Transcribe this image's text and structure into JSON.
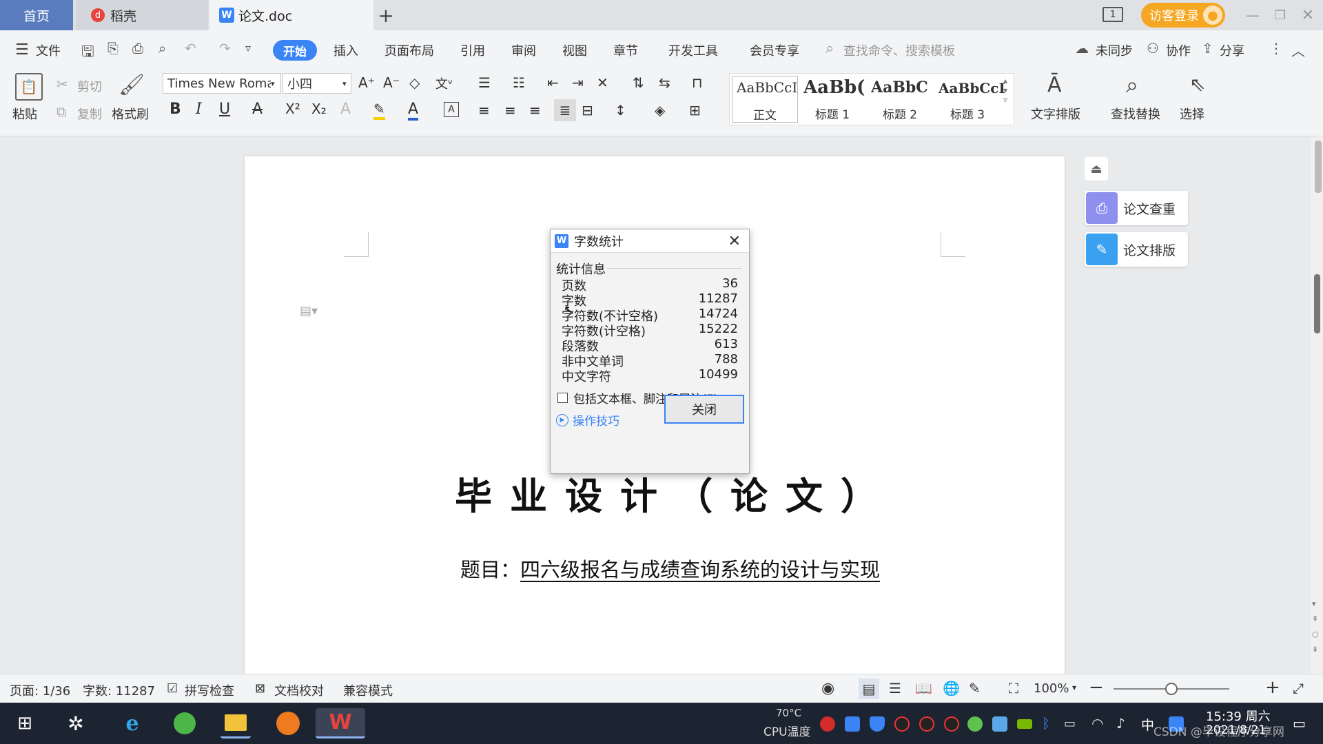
{
  "tabs": {
    "home": "首页",
    "daoke": "稻壳",
    "doc": "论文.doc",
    "add": "+"
  },
  "window": {
    "login": "访客登录",
    "page_indicator": "1"
  },
  "menubar": {
    "file": "文件",
    "items": [
      "开始",
      "插入",
      "页面布局",
      "引用",
      "审阅",
      "视图",
      "章节",
      "开发工具",
      "会员专享"
    ],
    "search_placeholder": "查找命令、搜索模板",
    "sync": "未同步",
    "collab": "协作",
    "share": "分享"
  },
  "ribbon": {
    "paste": "粘贴",
    "cut": "剪切",
    "copy": "复制",
    "format_painter": "格式刷",
    "font_name": "Times New Roman",
    "font_size": "小四",
    "styles": [
      {
        "preview": "AaBbCcI",
        "caption": "正文"
      },
      {
        "preview": "AaBb(",
        "caption": "标题 1"
      },
      {
        "preview": "AaBbC",
        "caption": "标题 2"
      },
      {
        "preview": "AaBbCcI",
        "caption": "标题 3"
      }
    ],
    "text_layout": "文字排版",
    "find_replace": "查找替换",
    "select": "选择"
  },
  "side_panel": {
    "check": "论文查重",
    "layout": "论文排版"
  },
  "document": {
    "title": "毕业设计（论文）",
    "subject_label": "题目：",
    "subject": "四六级报名与成绩查询系统的设计与实现"
  },
  "dialog": {
    "title": "字数统计",
    "section": "统计信息",
    "stats": [
      {
        "label": "页数",
        "value": "36"
      },
      {
        "label": "字数",
        "value": "11287"
      },
      {
        "label": "字符数(不计空格)",
        "value": "14724"
      },
      {
        "label": "字符数(计空格)",
        "value": "15222"
      },
      {
        "label": "段落数",
        "value": "613"
      },
      {
        "label": "非中文单词",
        "value": "788"
      },
      {
        "label": "中文字符",
        "value": "10499"
      }
    ],
    "checkbox_label": "包括文本框、脚注和尾注(F)",
    "tips": "操作技巧",
    "close": "关闭"
  },
  "statusbar": {
    "page": "页面: 1/36",
    "words": "字数: 11287",
    "spell": "拼写检查",
    "proof": "文档校对",
    "compat": "兼容模式",
    "zoom": "100%",
    "zoom_level": 0.5
  },
  "taskbar": {
    "temp": "70°C",
    "cpu": "CPU温度",
    "ime": "中",
    "time": "15:39 周六",
    "date": "2021/8/21",
    "watermark": "CSDN @毕设程序分享网"
  },
  "colors": {
    "accent": "#3a84f5",
    "home_tab": "#5a7cbf",
    "login": "#f5a623",
    "taskbar": "#1d2431"
  }
}
